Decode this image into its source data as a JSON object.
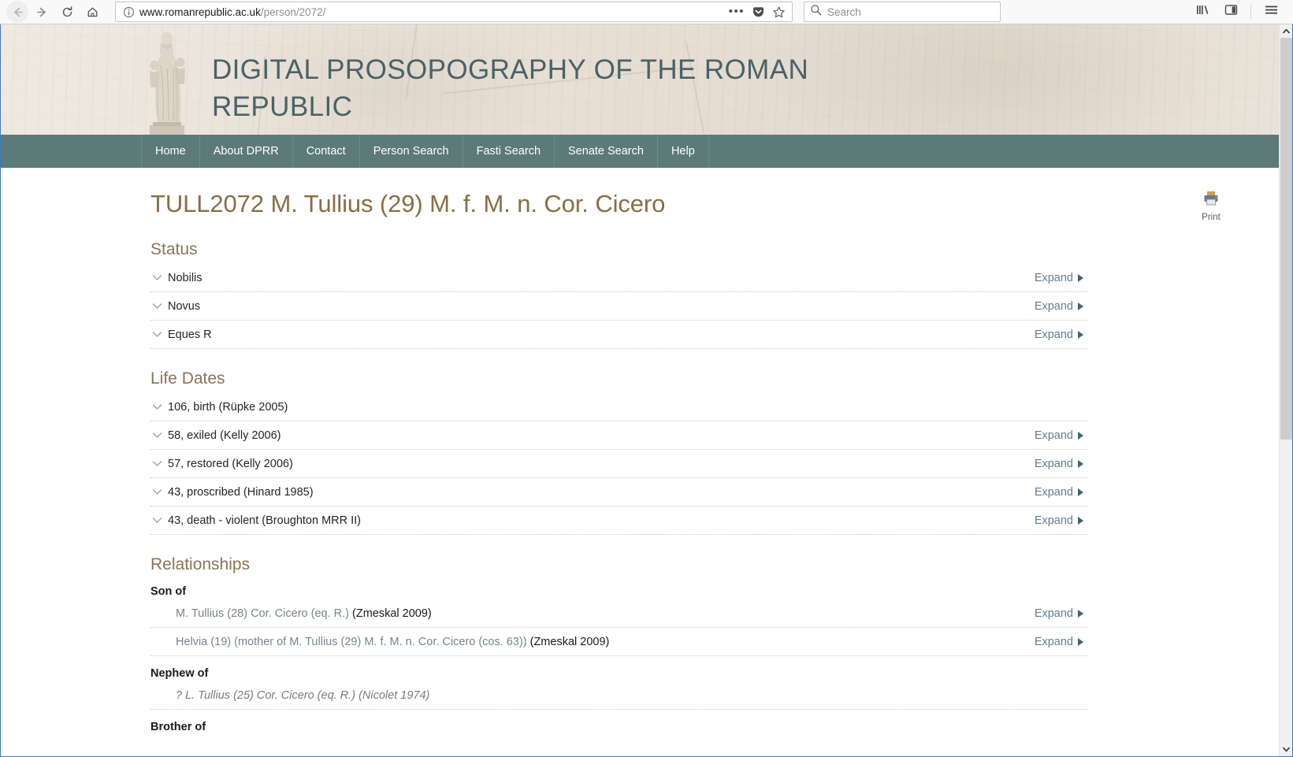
{
  "browser": {
    "back_icon": "back-arrow-icon",
    "forward_icon": "forward-arrow-icon",
    "reload_icon": "reload-icon",
    "home_icon": "home-icon",
    "url_host": "www.romanrepublic.ac.uk",
    "url_path": "/person/2072/",
    "url_full": "www.romanrepublic.ac.uk/person/2072/",
    "page_action_dots": "•••",
    "pocket_icon": "pocket-icon",
    "bookmark_icon": "star-icon",
    "search_placeholder": "Search",
    "library_icon": "library-icon",
    "sidebar_icon": "sidebar-icon",
    "menu_icon": "hamburger-menu-icon"
  },
  "site": {
    "banner_title_line1": "Digital Prosopography of the Roman",
    "banner_title_line2": "Republic",
    "statue_alt": "roman-togate-statue"
  },
  "nav": {
    "items": [
      {
        "label": "Home"
      },
      {
        "label": "About DPRR"
      },
      {
        "label": "Contact"
      },
      {
        "label": "Person Search"
      },
      {
        "label": "Fasti Search"
      },
      {
        "label": "Senate Search"
      },
      {
        "label": "Help"
      }
    ]
  },
  "main": {
    "page_title": "TULL2072 M. Tullius (29) M. f. M. n. Cor. Cicero",
    "print_label": "Print",
    "expand_label": "Expand",
    "sections": [
      {
        "heading": "Status",
        "rows": [
          {
            "label": "Nobilis",
            "expand": true
          },
          {
            "label": "Novus",
            "expand": true
          },
          {
            "label": "Eques R",
            "expand": true
          }
        ]
      },
      {
        "heading": "Life Dates",
        "rows": [
          {
            "label": "106, birth (Rüpke 2005)",
            "expand": false
          },
          {
            "label": "58, exiled (Kelly 2006)",
            "expand": true
          },
          {
            "label": "57, restored (Kelly 2006)",
            "expand": true
          },
          {
            "label": "43, proscribed (Hinard 1985)",
            "expand": true
          },
          {
            "label": "43, death - violent (Broughton MRR II)",
            "expand": true
          }
        ]
      }
    ],
    "relationships": {
      "heading": "Relationships",
      "groups": [
        {
          "title": "Son of",
          "entries": [
            {
              "link": "M. Tullius (28) Cor. Cicero (eq. R.)",
              "suffix": " (Zmeskal 2009)",
              "expand": true,
              "italic": false
            },
            {
              "link": "Helvia (19) (mother of M. Tullius (29) M. f. M. n. Cor. Cicero (cos. 63))",
              "suffix": " (Zmeskal 2009)",
              "expand": true,
              "italic": false
            }
          ]
        },
        {
          "title": "Nephew of",
          "entries": [
            {
              "link": "? L. Tullius (25) Cor. Cicero (eq. R.)",
              "suffix": " (Nicolet 1974)",
              "expand": false,
              "italic": true
            }
          ]
        },
        {
          "title": "Brother of",
          "entries": []
        }
      ]
    }
  },
  "colors": {
    "nav_bar": "#5c7a78",
    "title_brown": "#8a6e42",
    "section_brown": "#8b7355",
    "link_blue": "#5d7f92",
    "banner_title": "#4a6268"
  }
}
